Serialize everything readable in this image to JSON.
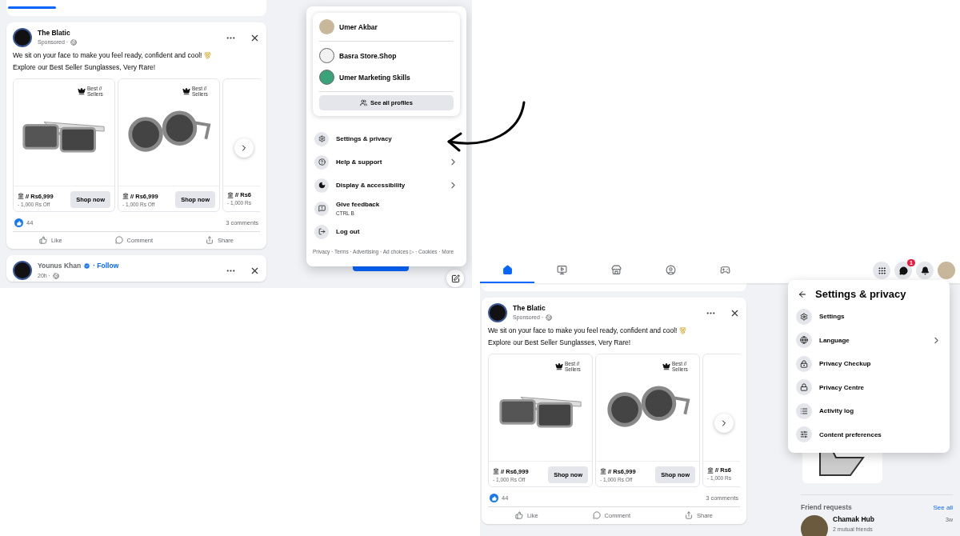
{
  "top_view": {
    "post": {
      "author": "The Blatic",
      "meta": "Sponsored ·",
      "lines": [
        "We sit on your face to make you feel ready, confident and cool!",
        "Explore our Best Seller Sunglasses, Very Rare!"
      ],
      "products": [
        {
          "badge": "Best // Sellers",
          "price": "// Rs6,999",
          "discount": "- 1,000 Rs Off",
          "button": "Shop now"
        },
        {
          "badge": "Best // Sellers",
          "price": "// Rs6,999",
          "discount": "- 1,000 Rs Off",
          "button": "Shop now"
        },
        {
          "price": "// Rs6",
          "discount": "- 1,000 Rs"
        }
      ],
      "likes": "44",
      "comments": "3 comments",
      "actions": [
        "Like",
        "Comment",
        "Share"
      ]
    },
    "next_post": {
      "author": "Younus Khan",
      "follow": "· Follow",
      "time": "20h ·"
    },
    "account_menu": {
      "profiles": [
        {
          "name": "Umer Akbar",
          "kind": "photo"
        },
        {
          "name": "Basra Store.Shop",
          "kind": "page"
        },
        {
          "name": "Umer Marketing Skills",
          "kind": "brand"
        }
      ],
      "see_all": "See all profiles",
      "items": [
        {
          "label": "Settings & privacy",
          "chevron": false
        },
        {
          "label": "Help & support",
          "chevron": true
        },
        {
          "label": "Display & accessibility",
          "chevron": true
        },
        {
          "label": "Give feedback",
          "sub": "CTRL B",
          "chevron": false
        },
        {
          "label": "Log out",
          "chevron": false
        }
      ],
      "footer": "Privacy · Terms · Advertising · Ad choices ▷ · Cookies · More"
    }
  },
  "bottom_view": {
    "nav_tabs": [
      {
        "selected": true
      },
      {
        "selected": false
      },
      {
        "selected": false
      },
      {
        "selected": false
      },
      {
        "selected": false
      }
    ],
    "messenger_badge": "1",
    "post": {
      "author": "The Blatic",
      "meta": "Sponsored ·",
      "lines": [
        "We sit on your face to make you feel ready, confident and cool!",
        "Explore our Best Seller Sunglasses, Very Rare!"
      ],
      "products": [
        {
          "badge": "Best // Sellers",
          "price": "// Rs6,999",
          "discount": "- 1,000 Rs Off",
          "button": "Shop now"
        },
        {
          "badge": "Best // Sellers",
          "price": "// Rs6,999",
          "discount": "- 1,000 Rs Off",
          "button": "Shop now"
        },
        {
          "price": "// Rs6",
          "discount": "- 1,000 Rs"
        }
      ],
      "likes": "44",
      "comments": "3 comments",
      "actions": [
        "Like",
        "Comment",
        "Share"
      ]
    },
    "settings_menu": {
      "title": "Settings & privacy",
      "items": [
        {
          "label": "Settings",
          "chevron": false
        },
        {
          "label": "Language",
          "chevron": true
        },
        {
          "label": "Privacy Checkup",
          "chevron": false
        },
        {
          "label": "Privacy Centre",
          "chevron": false
        },
        {
          "label": "Activity log",
          "chevron": false
        },
        {
          "label": "Content preferences",
          "chevron": false
        }
      ]
    },
    "friend_requests": {
      "title": "Friend requests",
      "see_all": "See all",
      "requests": [
        {
          "name": "Chamak Hub",
          "time": "3w",
          "mutual": "2 mutual friends"
        }
      ]
    }
  }
}
